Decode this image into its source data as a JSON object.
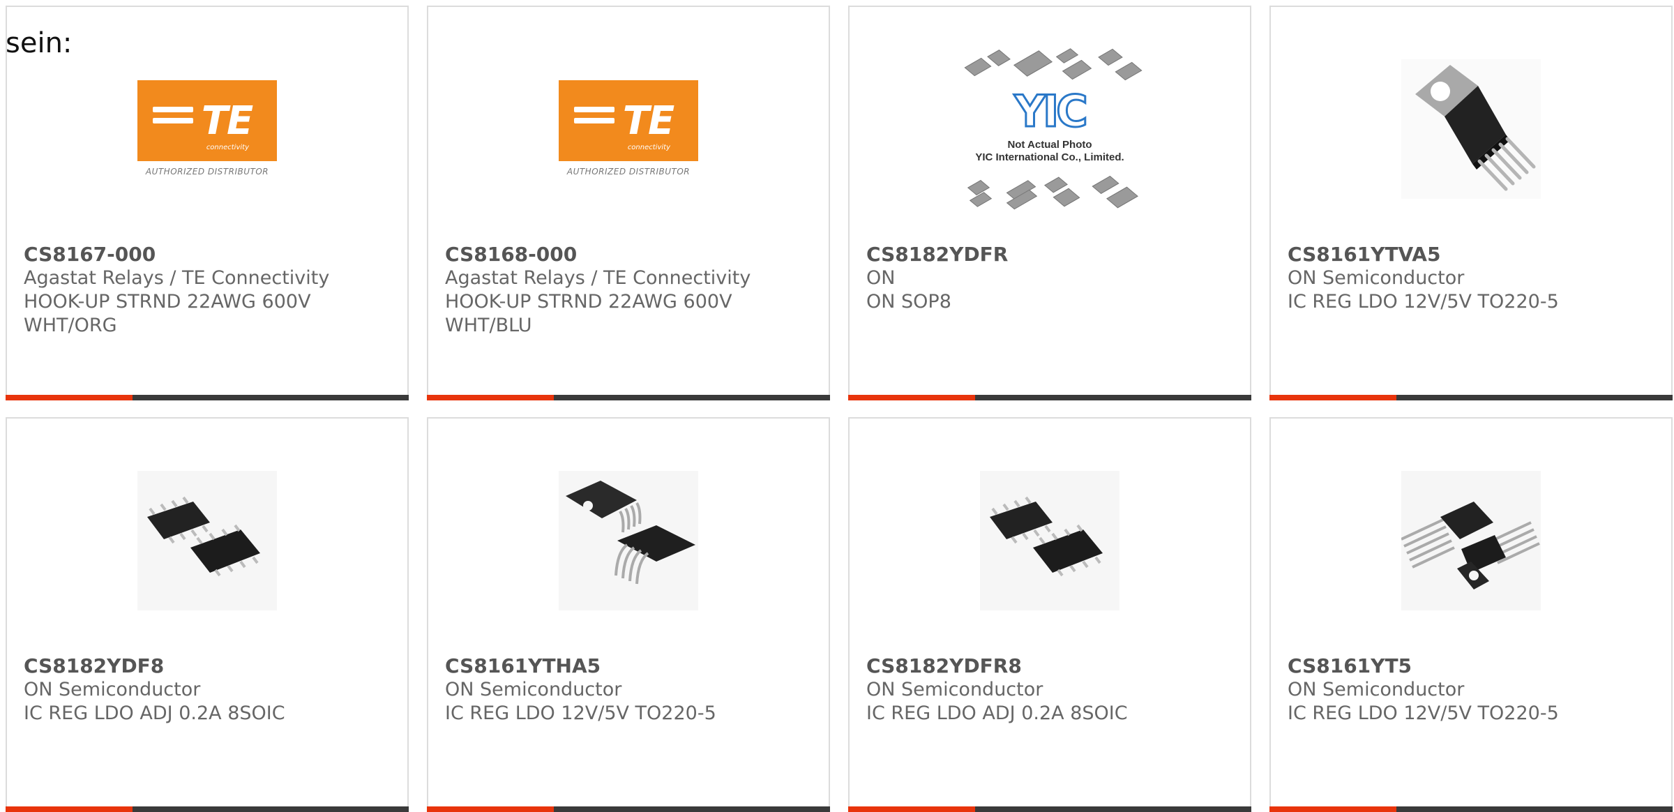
{
  "intro_text": "sein:",
  "products": [
    {
      "part_number": "CS8167-000",
      "manufacturer": "Agastat Relays / TE Connectivity",
      "description": "HOOK-UP STRND 22AWG 600V WHT/ORG",
      "image": "te-logo"
    },
    {
      "part_number": "CS8168-000",
      "manufacturer": "Agastat Relays / TE Connectivity",
      "description": "HOOK-UP STRND 22AWG 600V WHT/BLU",
      "image": "te-logo"
    },
    {
      "part_number": "CS8182YDFR",
      "manufacturer": "ON",
      "description": "ON SOP8",
      "image": "yic-placeholder"
    },
    {
      "part_number": "CS8161YTVA5",
      "manufacturer": "ON Semiconductor",
      "description": "IC REG LDO 12V/5V TO220-5",
      "image": "to220-5-photo"
    },
    {
      "part_number": "CS8182YDF8",
      "manufacturer": "ON Semiconductor",
      "description": "IC REG LDO ADJ 0.2A 8SOIC",
      "image": "soic8-photo"
    },
    {
      "part_number": "CS8161YTHA5",
      "manufacturer": "ON Semiconductor",
      "description": "IC REG LDO 12V/5V TO220-5",
      "image": "to220-5-bent-photo"
    },
    {
      "part_number": "CS8182YDFR8",
      "manufacturer": "ON Semiconductor",
      "description": "IC REG LDO ADJ 0.2A 8SOIC",
      "image": "soic8-photo"
    },
    {
      "part_number": "CS8161YT5",
      "manufacturer": "ON Semiconductor",
      "description": "IC REG LDO 12V/5V TO220-5",
      "image": "to220-5-straight-photo"
    }
  ],
  "te_logo": {
    "wordmark": "TE",
    "subtitle": "connectivity",
    "caption": "AUTHORIZED DISTRIBUTOR"
  },
  "yic_logo": {
    "wordmark": "YIC",
    "caption_line1": "Not Actual Photo",
    "caption_line2": "YIC International Co., Limited."
  },
  "colors": {
    "accent": "#e8340c",
    "bar": "#3a3a3a",
    "te_orange": "#f28a1d",
    "yic_blue": "#2a78c8"
  }
}
